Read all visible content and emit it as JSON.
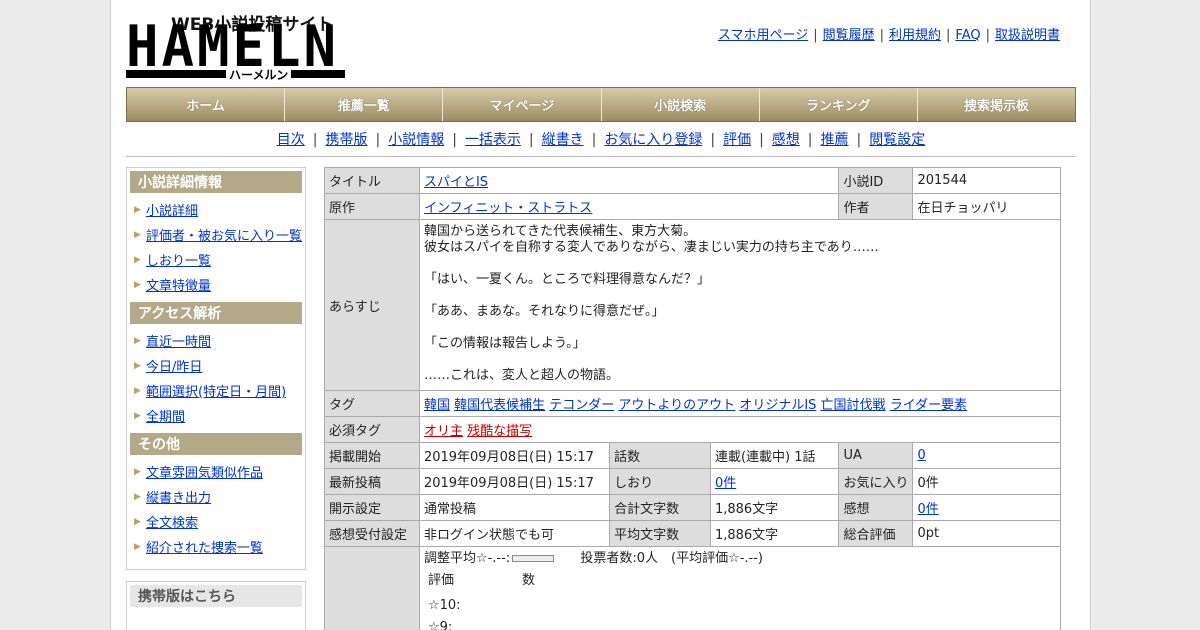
{
  "logo": {
    "sub": "WEB小説投稿サイト",
    "main": "HAMELN",
    "kana": "ハーメルン"
  },
  "top_links": [
    "スマホ用ページ",
    "閲覧履歴",
    "利用規約",
    "FAQ",
    "取扱説明書"
  ],
  "global_nav": [
    "ホーム",
    "推薦一覧",
    "マイページ",
    "小説検索",
    "ランキング",
    "捜索掲示板"
  ],
  "sub_nav": [
    "目次",
    "携帯版",
    "小説情報",
    "一括表示",
    "縦書き",
    "お気に入り登録",
    "評価",
    "感想",
    "推薦",
    "閲覧設定"
  ],
  "sidebar": {
    "sections": [
      {
        "title": "小説詳細情報",
        "items": [
          "小説詳細",
          "評価者・被お気に入り一覧",
          "しおり一覧",
          "文章特徴量"
        ]
      },
      {
        "title": "アクセス解析",
        "items": [
          "直近一時間",
          "今日/昨日",
          "範囲選択(特定日・月間)",
          "全期間"
        ]
      },
      {
        "title": "その他",
        "items": [
          "文章雰囲気類似作品",
          "縦書き出力",
          "全文検索",
          "紹介された捜索一覧"
        ]
      }
    ],
    "mobile_title": "携帯版はこちら"
  },
  "info": {
    "title_label": "タイトル",
    "title": "スパイとIS",
    "id_label": "小説ID",
    "id": "201544",
    "original_label": "原作",
    "original": "インフィニット・ストラトス",
    "author_label": "作者",
    "author": "在日チョッパリ",
    "synopsis_label": "あらすじ",
    "synopsis": [
      "韓国から送られてきた代表候補生、東方大菊。",
      "彼女はスパイを自称する変人でありながら、凄まじい実力の持ち主であり……",
      "",
      "「はい、一夏くん。ところで料理得意なんだ？」",
      "",
      "「ああ、まあな。それなりに得意だぜ。」",
      "",
      "「この情報は報告しよう。」",
      "",
      "……これは、変人と超人の物語。"
    ],
    "tags_label": "タグ",
    "tags": [
      "韓国",
      "韓国代表候補生",
      "テコンダー",
      "アウトよりのアウト",
      "オリジナルIS",
      "亡国討伐戦",
      "ライダー要素"
    ],
    "req_tags_label": "必須タグ",
    "req_tags": [
      "オリ主",
      "残酷な描写"
    ],
    "rows": [
      {
        "l1": "掲載開始",
        "v1": "2019年09月08日(日) 15:17",
        "l2": "話数",
        "v2": "連載(連載中) 1話",
        "l3": "UA",
        "v3": "0",
        "link3": true
      },
      {
        "l1": "最新投稿",
        "v1": "2019年09月08日(日) 15:17",
        "l2": "しおり",
        "v2": "0件",
        "link2": true,
        "l3": "お気に入り",
        "v3": "0件"
      },
      {
        "l1": "開示設定",
        "v1": "通常投稿",
        "l2": "合計文字数",
        "v2": "1,886文字",
        "l3": "感想",
        "v3": "0件",
        "link3": true
      },
      {
        "l1": "感想受付設定",
        "v1": "非ログイン状態でも可",
        "l2": "平均文字数",
        "v2": "1,886文字",
        "l3": "総合評価",
        "v3": "0pt"
      }
    ],
    "rating": {
      "avg_label": "調整平均☆-.--:",
      "voters": "投票者数:0人　(平均評価☆-.--)",
      "col_rating": "評価",
      "col_count": "数",
      "stars": [
        "☆10:",
        "☆9:"
      ]
    }
  }
}
